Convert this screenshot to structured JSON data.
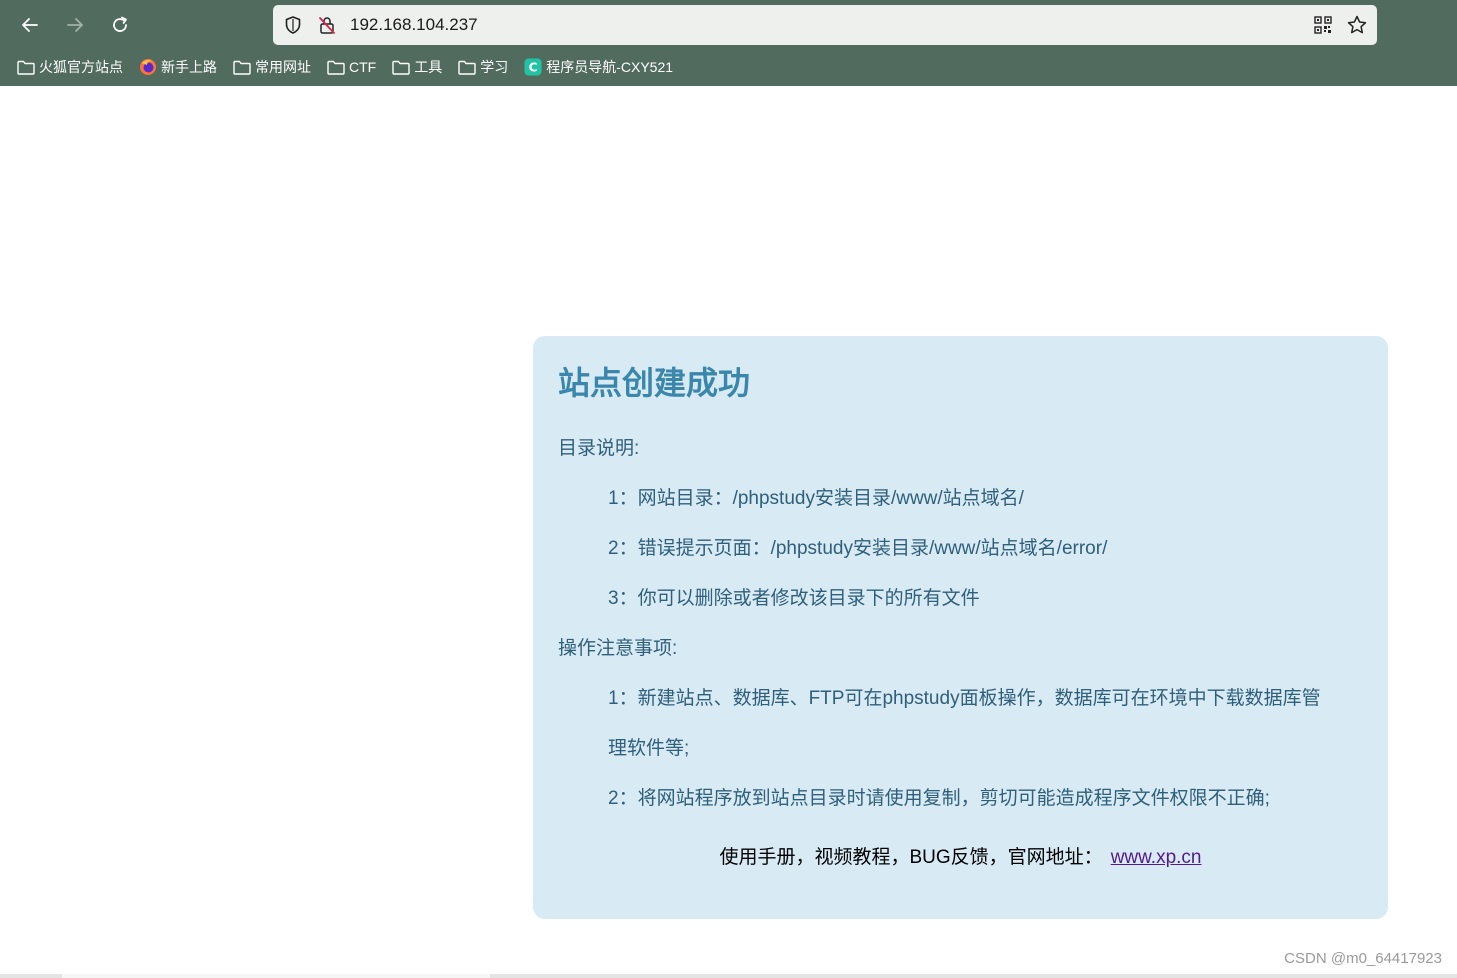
{
  "browser": {
    "url": "192.168.104.237",
    "bookmarks": [
      {
        "label": "火狐官方站点",
        "icon": "folder-icon"
      },
      {
        "label": "新手上路",
        "icon": "firefox-icon"
      },
      {
        "label": "常用网址",
        "icon": "folder-icon"
      },
      {
        "label": "CTF",
        "icon": "folder-icon"
      },
      {
        "label": "工具",
        "icon": "folder-icon"
      },
      {
        "label": "学习",
        "icon": "folder-icon"
      },
      {
        "label": "程序员导航-CXY521",
        "icon": "site-c-icon"
      }
    ],
    "chrome_color": "#516c5e"
  },
  "page": {
    "title": "站点创建成功",
    "dir_section_label": "目录说明:",
    "dir_items": [
      "1：网站目录：/phpstudy安装目录/www/站点域名/",
      "2：错误提示页面：/phpstudy安装目录/www/站点域名/error/",
      "3：你可以删除或者修改该目录下的所有文件"
    ],
    "ops_section_label": "操作注意事项:",
    "ops_items": [
      "1：新建站点、数据库、FTP可在phpstudy面板操作，数据库可在环境中下载数据库管",
      "理软件等;",
      "2：将网站程序放到站点目录时请使用复制，剪切可能造成程序文件权限不正确;"
    ],
    "footer_text": "使用手册，视频教程，BUG反馈，官网地址：",
    "footer_link": "www.xp.cn",
    "card_bg": "#d8ebf5",
    "title_color": "#3b86ab"
  },
  "watermark": "CSDN @m0_64417923"
}
